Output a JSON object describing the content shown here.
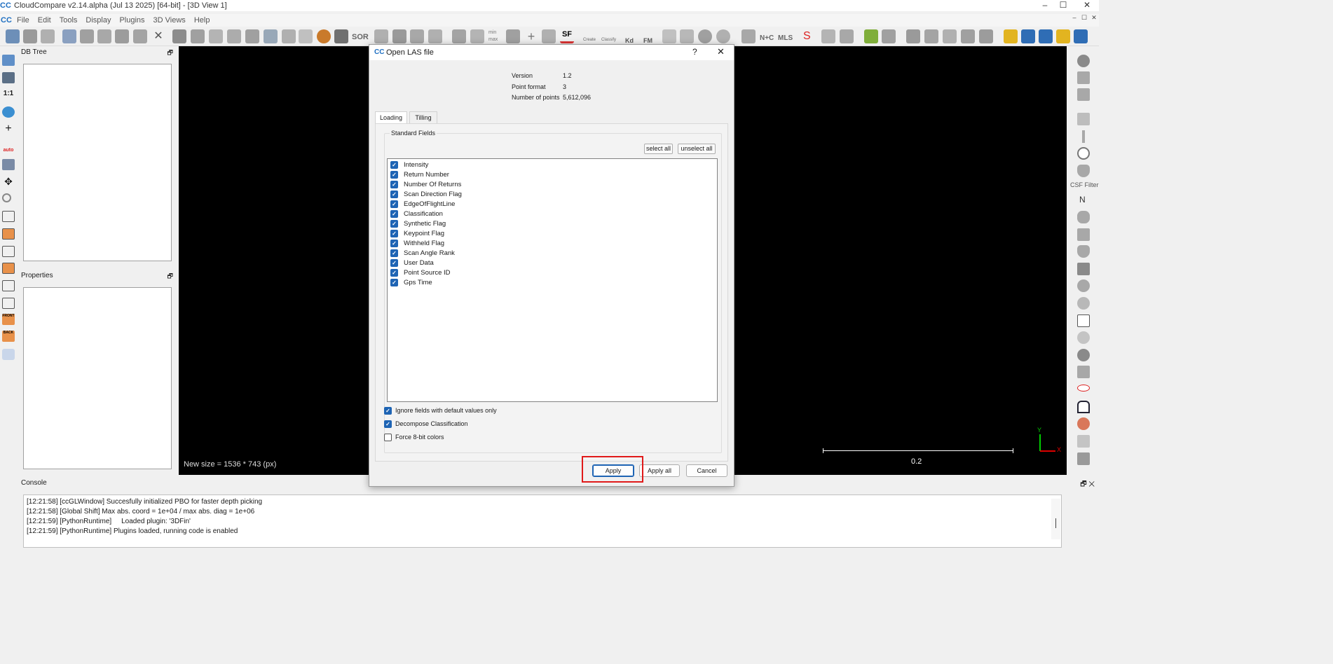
{
  "window": {
    "title": "CloudCompare v2.14.alpha (Jul 13 2025) [64-bit] - [3D View 1]",
    "logo": "CC",
    "controls": [
      "–",
      "☐",
      "✕"
    ]
  },
  "menu": {
    "logo": "CC",
    "items": [
      "File",
      "Edit",
      "Tools",
      "Display",
      "Plugins",
      "3D Views",
      "Help"
    ],
    "mdi_controls": [
      "–",
      "☐",
      "✕"
    ]
  },
  "toolbar": {
    "sor_label": "SOR",
    "sf_label": "SF",
    "kd_label": "Kd",
    "fm_label": "FM",
    "nc_label": "N+C",
    "mls_label": "MLS",
    "s_label": "S",
    "create_label": "Create",
    "classify_label": "Classify",
    "minmax_label": "min max"
  },
  "left_toolbar": {
    "ratio_label": "1:1",
    "auto_label": "auto",
    "front_label": "FRONT",
    "back_label": "BACK"
  },
  "panels": {
    "db_tree_title": "DB Tree",
    "properties_title": "Properties",
    "float_icon": "🗗"
  },
  "view": {
    "status": "New size = 1536 * 743 (px)",
    "scale_value": "0.2",
    "axis_y": "Y",
    "axis_x": "X"
  },
  "right_toolbar": {
    "csf_label": "CSF Filter",
    "n_label": "N"
  },
  "dialog": {
    "title": "Open LAS file",
    "help": "?",
    "close": "✕",
    "info": {
      "version_label": "Version",
      "version_value": "1.2",
      "format_label": "Point format",
      "format_value": "3",
      "points_label": "Number of points",
      "points_value": "5,612,096"
    },
    "tabs": [
      "Loading",
      "Tilling"
    ],
    "group_title": "Standard Fields",
    "select_all": "select all",
    "unselect_all": "unselect all",
    "fields": [
      "Intensity",
      "Return Number",
      "Number Of Returns",
      "Scan Direction Flag",
      "EdgeOfFlightLine",
      "Classification",
      "Synthetic Flag",
      "Keypoint Flag",
      "Withheld Flag",
      "Scan Angle Rank",
      "User Data",
      "Point Source ID",
      "Gps Time"
    ],
    "options": {
      "ignore_default": "Ignore fields with default values only",
      "decompose": "Decompose Classification",
      "force8bit": "Force 8-bit colors"
    },
    "buttons": {
      "apply": "Apply",
      "apply_all": "Apply all",
      "cancel": "Cancel"
    }
  },
  "console": {
    "title": "Console",
    "lines": [
      "[12:21:58] [ccGLWindow] Succesfully initialized PBO for faster depth picking",
      "[12:21:58] [Global Shift] Max abs. coord = 1e+04 / max abs. diag = 1e+06",
      "[12:21:59] [PythonRuntime]     Loaded plugin: '3DFin'",
      "[12:21:59] [PythonRuntime] Plugins loaded, running code is enabled"
    ],
    "controls": "🗗 ✕"
  },
  "colors": {
    "accent": "#1e64b4",
    "highlight": "#e01a1a",
    "viewport": "#000000"
  }
}
